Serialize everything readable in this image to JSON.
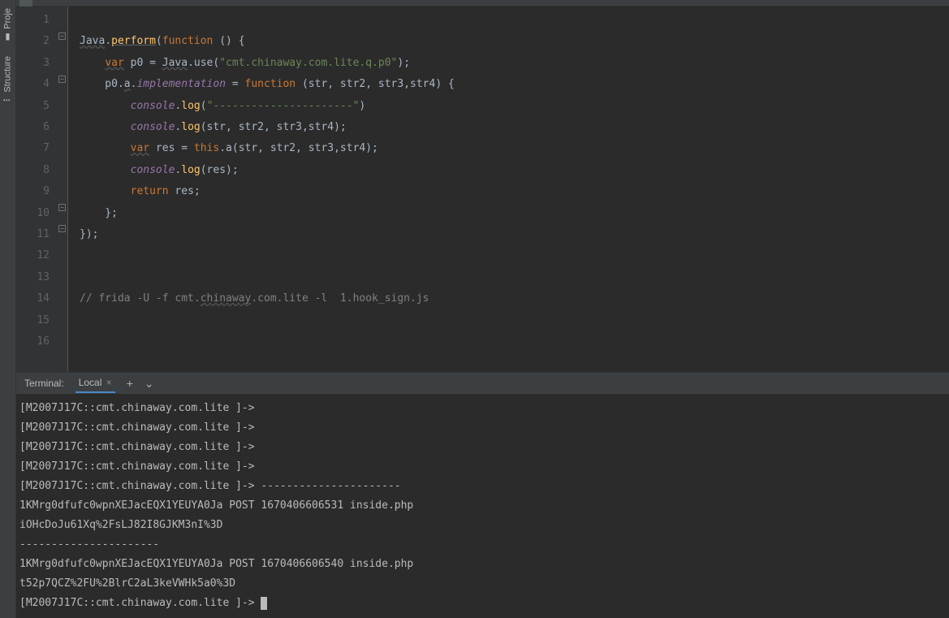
{
  "sidebar": {
    "project": "Proje",
    "structure": "Structure"
  },
  "gutter": [
    "1",
    "2",
    "3",
    "4",
    "5",
    "6",
    "7",
    "8",
    "9",
    "10",
    "11",
    "12",
    "13",
    "14",
    "15",
    "16"
  ],
  "code": {
    "l1": "",
    "l2_java": "Java",
    "l2_perform": "perform",
    "l2_func": "function",
    "l3_var": "var",
    "l3_p0eq": " p0 = ",
    "l3_java": "Java",
    "l3_use": ".use(",
    "l3_str": "\"cmt.chinaway.com.lite.q.p0\"",
    "l3_end": ");",
    "l4_p0a": "    p0.",
    "l4_a": "a",
    "l4_dot": ".",
    "l4_impl": "implementation",
    "l4_eq": " = ",
    "l4_func": "function",
    "l4_args": " (str, str2, str3,str4) {",
    "l5_console": "console",
    "l5_log": "log",
    "l5_str": "\"----------------------\"",
    "l6_console": "console",
    "l6_log": "log",
    "l6_args": "(str, str2, str3,str4);",
    "l7_var": "var",
    "l7_reseq": " res = ",
    "l7_this": "this",
    "l7_call": ".a(str, str2, str3,str4);",
    "l8_console": "console",
    "l8_log": "log",
    "l8_args": "(res);",
    "l9_return": "return",
    "l9_res": " res;",
    "l10": "    };",
    "l11": "});",
    "l12": "",
    "l13": "",
    "l14_cmt1": "// frida -U -f cmt.",
    "l14_chinaway": "chinaway",
    "l14_cmt2": ".com.lite -l  1.hook_sign.js",
    "l15": "",
    "l16": ""
  },
  "terminal": {
    "label": "Terminal:",
    "tab": "Local",
    "lines": [
      "[M2007J17C::cmt.chinaway.com.lite ]->",
      "[M2007J17C::cmt.chinaway.com.lite ]->",
      "[M2007J17C::cmt.chinaway.com.lite ]->",
      "[M2007J17C::cmt.chinaway.com.lite ]->",
      "[M2007J17C::cmt.chinaway.com.lite ]-> ----------------------",
      "1KMrg0dfufc0wpnXEJacEQX1YEUYA0Ja POST 1670406606531 inside.php",
      "iOHcDoJu61Xq%2FsLJ82I8GJKM3nI%3D",
      "----------------------",
      "1KMrg0dfufc0wpnXEJacEQX1YEUYA0Ja POST 1670406606540 inside.php",
      "t52p7QCZ%2FU%2BlrC2aL3keVWHk5a0%3D",
      "[M2007J17C::cmt.chinaway.com.lite ]-> "
    ]
  }
}
